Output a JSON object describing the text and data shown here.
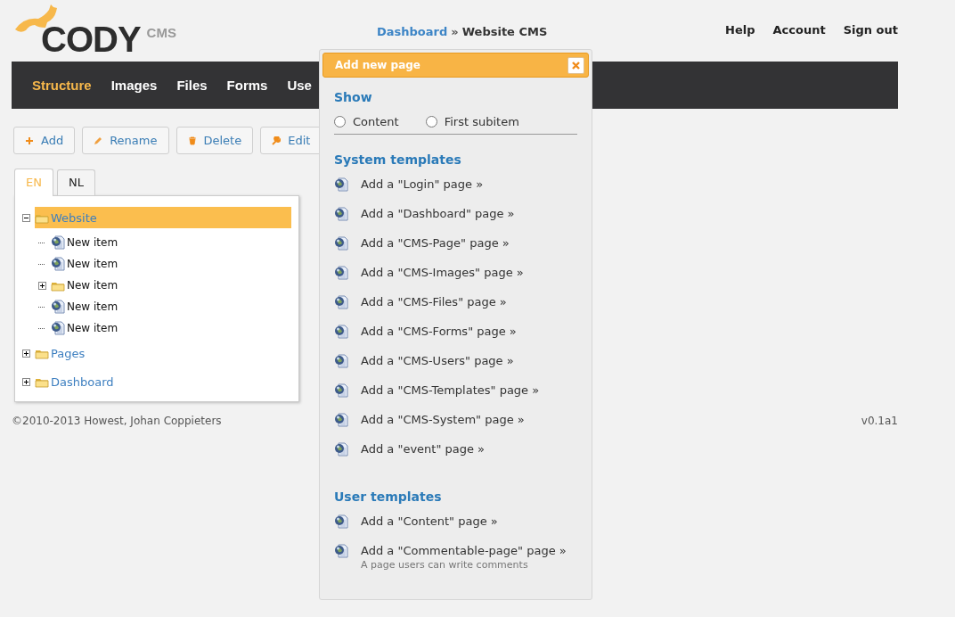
{
  "logo": {
    "name": "CODY",
    "suffix": "CMS"
  },
  "breadcrumb": {
    "link": "Dashboard",
    "separator": "»",
    "current": "Website CMS"
  },
  "top_links": [
    "Help",
    "Account",
    "Sign out"
  ],
  "nav": [
    {
      "label": "Structure",
      "selected": true
    },
    {
      "label": "Images",
      "selected": false
    },
    {
      "label": "Files",
      "selected": false
    },
    {
      "label": "Forms",
      "selected": false
    },
    {
      "label": "Use",
      "selected": false
    }
  ],
  "toolbar": [
    {
      "label": "Add",
      "kind": "add"
    },
    {
      "label": "Rename",
      "kind": "rename"
    },
    {
      "label": "Delete",
      "kind": "delete"
    },
    {
      "label": "Edit",
      "kind": "edit"
    }
  ],
  "language_tabs": [
    {
      "label": "EN",
      "selected": true
    },
    {
      "label": "NL",
      "selected": false
    }
  ],
  "tree": [
    {
      "label": "Website",
      "kind": "folder",
      "expanded": true,
      "selected": true,
      "children": [
        {
          "label": "New item",
          "kind": "page",
          "selected": false
        },
        {
          "label": "New item",
          "kind": "page",
          "selected": false
        },
        {
          "label": "New item",
          "kind": "folder",
          "expanded": false,
          "selected": false
        },
        {
          "label": "New item",
          "kind": "page",
          "selected": false
        },
        {
          "label": "New item",
          "kind": "page",
          "selected": false
        }
      ]
    },
    {
      "label": "Pages",
      "kind": "folder",
      "expanded": false,
      "selected": false
    },
    {
      "label": "Dashboard",
      "kind": "folder",
      "expanded": false,
      "selected": false
    }
  ],
  "footer": {
    "copyright": "©2010-2013 Howest, Johan Coppieters",
    "version": "v0.1a1"
  },
  "dialog": {
    "title": "Add new page",
    "show_heading": "Show",
    "show_options": [
      {
        "label": "Content",
        "selected": false
      },
      {
        "label": "First subitem",
        "selected": false
      }
    ],
    "sections": [
      {
        "heading": "System templates",
        "items": [
          {
            "label": "Add a \"Login\" page »"
          },
          {
            "label": "Add a \"Dashboard\" page »"
          },
          {
            "label": "Add a \"CMS-Page\" page »"
          },
          {
            "label": "Add a \"CMS-Images\" page »"
          },
          {
            "label": "Add a \"CMS-Files\" page »"
          },
          {
            "label": "Add a \"CMS-Forms\" page »"
          },
          {
            "label": "Add a \"CMS-Users\" page »"
          },
          {
            "label": "Add a \"CMS-Templates\" page »"
          },
          {
            "label": "Add a \"CMS-System\" page »"
          },
          {
            "label": "Add a \"event\" page »"
          }
        ]
      },
      {
        "heading": "User templates",
        "items": [
          {
            "label": "Add a \"Content\" page »"
          },
          {
            "label": "Add a \"Commentable-page\" page »",
            "description": "A page users can write comments"
          }
        ]
      }
    ]
  }
}
